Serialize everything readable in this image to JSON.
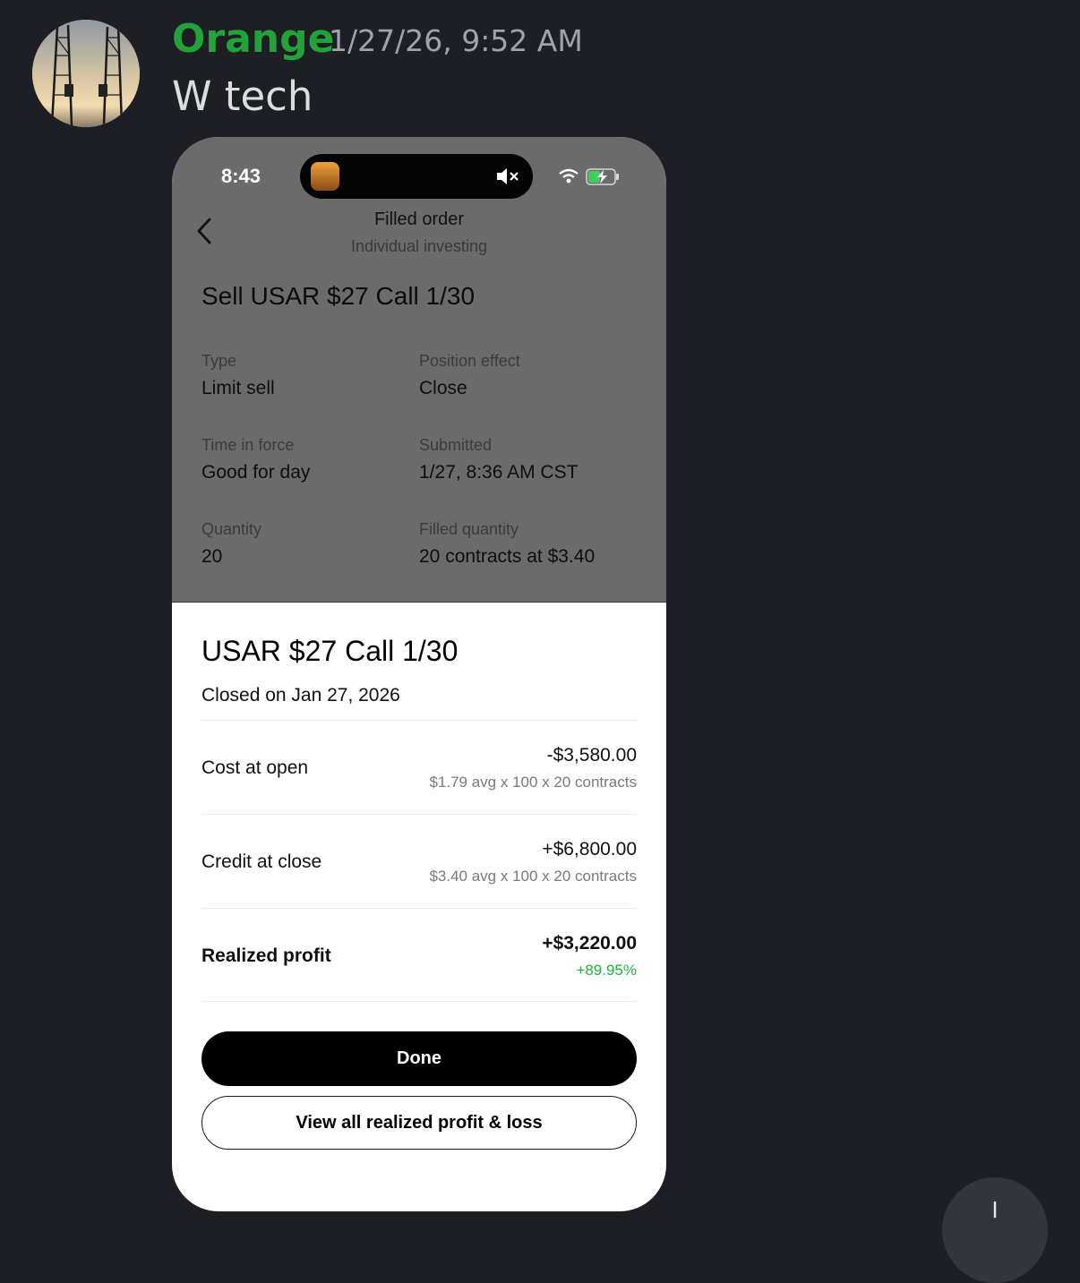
{
  "message": {
    "author": "Orange",
    "timestamp": "1/27/26, 9:52 AM",
    "text": "W tech"
  },
  "phone": {
    "status_bar": {
      "time": "8:43"
    },
    "nav": {
      "title": "Filled order",
      "subtitle": "Individual investing"
    },
    "order": {
      "title": "Sell USAR $27 Call 1/30",
      "fields": [
        {
          "label": "Type",
          "value": "Limit sell"
        },
        {
          "label": "Position effect",
          "value": "Close"
        },
        {
          "label": "Time in force",
          "value": "Good for day"
        },
        {
          "label": "Submitted",
          "value": "1/27, 8:36 AM CST"
        },
        {
          "label": "Quantity",
          "value": "20"
        },
        {
          "label": "Filled quantity",
          "value": "20 contracts at $3.40"
        }
      ]
    },
    "sheet": {
      "title": "USAR $27 Call 1/30",
      "subtitle": "Closed on Jan 27, 2026",
      "rows": [
        {
          "label": "Cost at open",
          "amount": "-$3,580.00",
          "detail": "$1.79 avg x 100 x 20 contracts"
        },
        {
          "label": "Credit at close",
          "amount": "+$6,800.00",
          "detail": "$3.40 avg x 100 x 20 contracts"
        },
        {
          "label": "Realized profit",
          "amount": "+$3,220.00",
          "detail": "+89.95%"
        }
      ],
      "done_label": "Done",
      "view_all_label": "View all realized profit & loss"
    }
  },
  "colors": {
    "author": "#23a23a",
    "profit_green": "#1fb33b",
    "background": "#1e1f25"
  }
}
